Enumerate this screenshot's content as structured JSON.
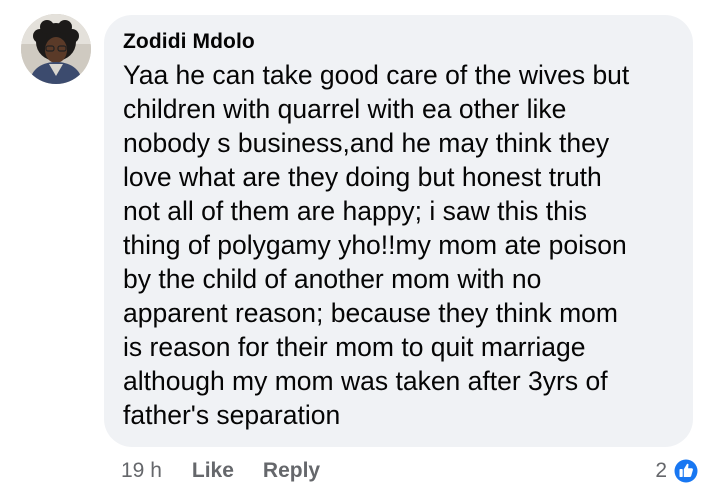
{
  "comment": {
    "author": "Zodidi Mdolo",
    "text": "Yaa he can take good care of the wives but\nchildren with quarrel with ea other like\nnobody s business,and he may think they\nlove what are they doing but honest truth\nnot all of them are happy; i saw this this\nthing of polygamy yho!!my mom ate  poison\nby the child of another mom with no\napparent reason; because they think mom\nis reason for their mom to quit marriage\nalthough my mom was taken after 3yrs of\nfather's separation"
  },
  "actions": {
    "time": "19 h",
    "like_label": "Like",
    "reply_label": "Reply"
  },
  "reactions": {
    "count": "2",
    "icon": "like-reaction-icon",
    "color": "#1877f2"
  },
  "colors": {
    "bubble": "#f0f2f5",
    "meta_text": "#65676b",
    "body_text": "#050505"
  }
}
